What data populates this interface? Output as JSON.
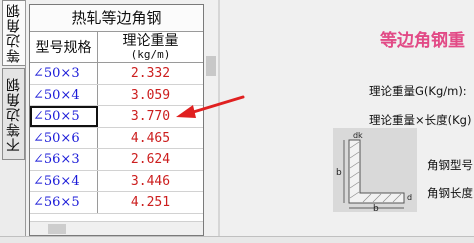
{
  "tabs": [
    {
      "label": "等边角钢",
      "active": true
    },
    {
      "label": "不等边角钢",
      "active": false
    }
  ],
  "table": {
    "title": "热轧等边角钢",
    "header_spec": "型号规格",
    "header_weight": "理论重量",
    "header_unit": "(kg/m)",
    "rows": [
      {
        "spec": "∠50×3",
        "weight": "2.332"
      },
      {
        "spec": "∠50×4",
        "weight": "3.059"
      },
      {
        "spec": "∠50×5",
        "weight": "3.770"
      },
      {
        "spec": "∠50×6",
        "weight": "4.465"
      },
      {
        "spec": "∠56×3",
        "weight": "2.624"
      },
      {
        "spec": "∠56×4",
        "weight": "3.446"
      },
      {
        "spec": "∠56×5",
        "weight": "4.251"
      }
    ],
    "selected_row": "∠50×5"
  },
  "right_panel": {
    "title": "等边角钢重",
    "weight_label": "理论重量G(Kg/m):",
    "total_label": "理论重量×长度(Kg)",
    "model_label": "角钢型号",
    "length_label": "角钢长度",
    "diagram_letters": {
      "d_top": "d",
      "k": "k",
      "b_side": "b",
      "b_bottom": "b",
      "d_right": "d"
    }
  },
  "colors": {
    "spec_text": "#1a1ad8",
    "weight_text": "#cc1e1e",
    "title_accent": "#e24a86",
    "arrow": "#e02020"
  }
}
